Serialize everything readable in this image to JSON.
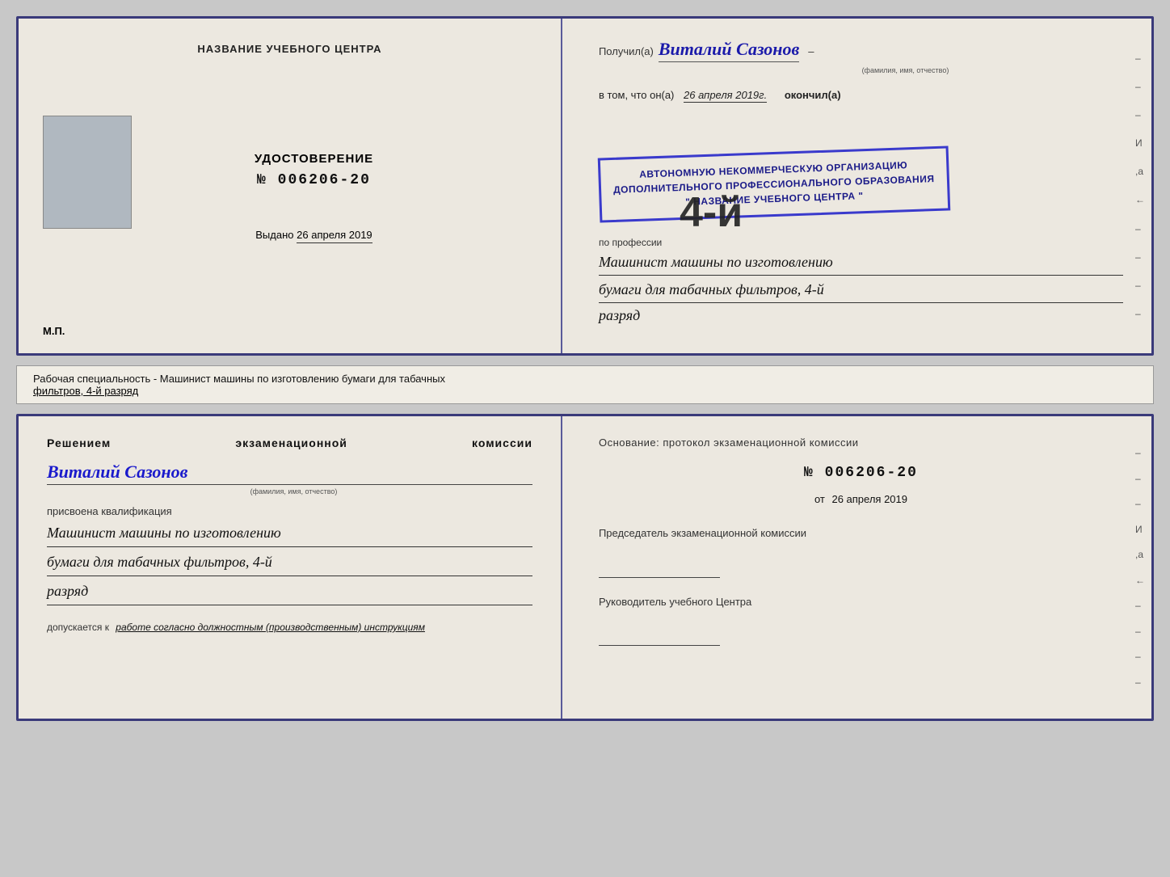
{
  "page": {
    "background_color": "#c8c8c8"
  },
  "certificate": {
    "left_section_title": "НАЗВАНИЕ УЧЕБНОГО ЦЕНТРА",
    "cert_label": "УДОСТОВЕРЕНИЕ",
    "cert_number_prefix": "№",
    "cert_number": "006206-20",
    "issued_label": "Выдано",
    "issued_date": "26 апреля 2019",
    "mp_label": "М.П.",
    "photo_alt": "фото"
  },
  "recipient": {
    "received_label": "Получил(а)",
    "name": "Виталий Сазонов",
    "name_subtitle": "(фамилия, имя, отчество)",
    "vtom_label": "в том, что он(а)",
    "completion_date": "26 апреля 2019г.",
    "okончил_label": "окончил(а)"
  },
  "organization": {
    "line1": "АВТОНОМНУЮ НЕКОММЕРЧЕСКУЮ ОРГАНИЗАЦИЮ",
    "line2": "ДОПОЛНИТЕЛЬНОГО ПРОФЕССИОНАЛЬНОГО ОБРАЗОВАНИЯ",
    "line3": "\" НАЗВАНИЕ УЧЕБНОГО ЦЕНТРА \"",
    "dash1": "–",
    "dash2": "–",
    "dash3": "–",
    "И_label": "И",
    "а_label": ",а",
    "arrow_label": "←"
  },
  "profession": {
    "по_профессии_label": "по профессии",
    "name_line1": "Машинист машины по изготовлению",
    "name_line2": "бумаги для табачных фильтров, 4-й",
    "name_line3": "разряд"
  },
  "info_bar": {
    "text": "Рабочая специальность - Машинист машины по изготовлению бумаги для табачных",
    "text2": "фильтров, 4-й разряд"
  },
  "exam_section": {
    "left": {
      "heading": "Решением  экзаменационной  комиссии",
      "person_name": "Виталий Сазонов",
      "name_subtitle": "(фамилия, имя, отчество)",
      "присвоена_label": "присвоена квалификация",
      "qualification_line1": "Машинист машины по изготовлению",
      "qualification_line2": "бумаги для табачных фильтров, 4-й",
      "qualification_line3": "разряд",
      "допускается_label": "допускается к",
      "допускается_value": "работе согласно должностным (производственным) инструкциям"
    },
    "right": {
      "основание_label": "Основание: протокол экзаменационной  комиссии",
      "number_prefix": "№",
      "number": "006206-20",
      "ot_label": "от",
      "ot_date": "26 апреля 2019",
      "chairman_label": "Председатель экзаменационной комиссии",
      "head_label": "Руководитель учебного Центра",
      "dashes": [
        "–",
        "–",
        "–",
        "И",
        ",а",
        "←",
        "–",
        "–",
        "–",
        "–"
      ]
    }
  }
}
